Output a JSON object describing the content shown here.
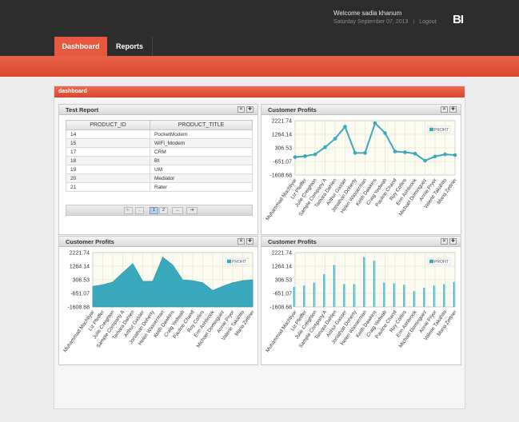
{
  "header": {
    "welcome": "Welcome sadia khanum",
    "date": "Saturday September 07, 2013",
    "logout": "Logout",
    "logo": "BI",
    "accent": "#e8583f"
  },
  "nav": {
    "tabs": [
      {
        "label": "Dashboard",
        "active": true
      },
      {
        "label": "Reports",
        "active": false
      }
    ]
  },
  "main": {
    "title": "dashboard"
  },
  "panels": {
    "test_report": {
      "title": "Test Report",
      "close_icon": "close-icon",
      "expand_icon": "expand-icon"
    },
    "profits_line": {
      "title": "Customer Profits"
    },
    "profits_area": {
      "title": "Customer Profits"
    },
    "profits_bar": {
      "title": "Customer Profits"
    }
  },
  "table": {
    "columns": [
      "PRODUCT_ID",
      "PRODUCT_TITLE"
    ],
    "rows": [
      [
        "14",
        "PocketModem"
      ],
      [
        "15",
        "WiFi_Modem"
      ],
      [
        "17",
        "CRM"
      ],
      [
        "18",
        "BI"
      ],
      [
        "19",
        "UM"
      ],
      [
        "20",
        "Mediator"
      ],
      [
        "21",
        "Rater"
      ]
    ],
    "pager": {
      "first": "⇤",
      "prev": "←",
      "pages": [
        "1",
        "2"
      ],
      "current": "1",
      "next": "→",
      "last": "⇥"
    }
  },
  "chart_data": [
    {
      "type": "line",
      "title": "Customer Profits",
      "legend": "PROFIT",
      "legend_position": "top-right",
      "color": "#3aa9bd",
      "yticks": [
        "2221.74",
        "1264.14",
        "306.53",
        "-651.07",
        "-1608.68"
      ],
      "ylim": [
        -1608.68,
        2221.74
      ],
      "categories": [
        "Muhammad Machtiyar",
        "Liz Pfeiffer",
        "Julie Creighton",
        "Sample Company A",
        "Tamara Dahlen",
        "Arthur Gasser",
        "Jonathan Doherty",
        "Helen Wasserman",
        "Keith Dawkins",
        "Craig Yedwab",
        "Pauline Chand",
        "Roy Collins",
        "Erin Ashbrook",
        "Michael Dominguez",
        "Annie Pryor",
        "Valerie Takahito",
        "Maria Zettner"
      ],
      "series": [
        {
          "name": "PROFIT",
          "values": [
            -350,
            -280,
            -150,
            350,
            950,
            1800,
            -50,
            -50,
            2050,
            1350,
            50,
            0,
            -100,
            -600,
            -300,
            -150,
            -200
          ]
        }
      ]
    },
    {
      "type": "area",
      "title": "Customer Profits",
      "legend": "PROFIT",
      "legend_position": "top-right",
      "color": "#3aa9bd",
      "yticks": [
        "2221.74",
        "1264.14",
        "306.53",
        "-651.07",
        "-1608.68"
      ],
      "ylim": [
        -1608.68,
        2221.74
      ],
      "categories": [
        "Muhammad Machtiyar",
        "Liz Pfeiffer",
        "Julie Creighton",
        "Sample Company A",
        "Tamara Dahlen",
        "Arthur Gasser",
        "Jonathan Doherty",
        "Helen Wasserman",
        "Keith Dawkins",
        "Craig Yedwab",
        "Pauline Chand",
        "Roy Collins",
        "Erin Ashbrook",
        "Michael Dominguez",
        "Annie Pryor",
        "Valerie Takahito",
        "Maria Zettner"
      ],
      "series": [
        {
          "name": "PROFIT",
          "values": [
            -150,
            -50,
            150,
            800,
            1450,
            200,
            200,
            1900,
            1350,
            300,
            250,
            100,
            -450,
            -150,
            100,
            250,
            300
          ]
        }
      ]
    },
    {
      "type": "bar",
      "title": "Customer Profits",
      "legend": "PROFIT",
      "legend_position": "top-right",
      "color": "#3aa9bd",
      "yticks": [
        "2221.74",
        "1264.14",
        "306.53",
        "-651.07",
        "-1608.68"
      ],
      "ylim": [
        -1608.68,
        2221.74
      ],
      "categories": [
        "Muhammad Machtiyar",
        "Liz Pfeiffer",
        "Julie Creighton",
        "Sample Company A",
        "Tamara Dahlen",
        "Arthur Gasser",
        "Jonathan Doherty",
        "Helen Wasserman",
        "Keith Dawkins",
        "Craig Yedwab",
        "Pauline Chand",
        "Roy Collins",
        "Erin Ashbrook",
        "Michael Dominguez",
        "Annie Pryor",
        "Valerie Takahito",
        "Maria Zettner"
      ],
      "series": [
        {
          "name": "PROFIT",
          "values": [
            -200,
            -100,
            100,
            700,
            1350,
            0,
            0,
            1900,
            1650,
            100,
            50,
            -50,
            -500,
            -250,
            -100,
            0,
            150
          ]
        }
      ]
    }
  ]
}
